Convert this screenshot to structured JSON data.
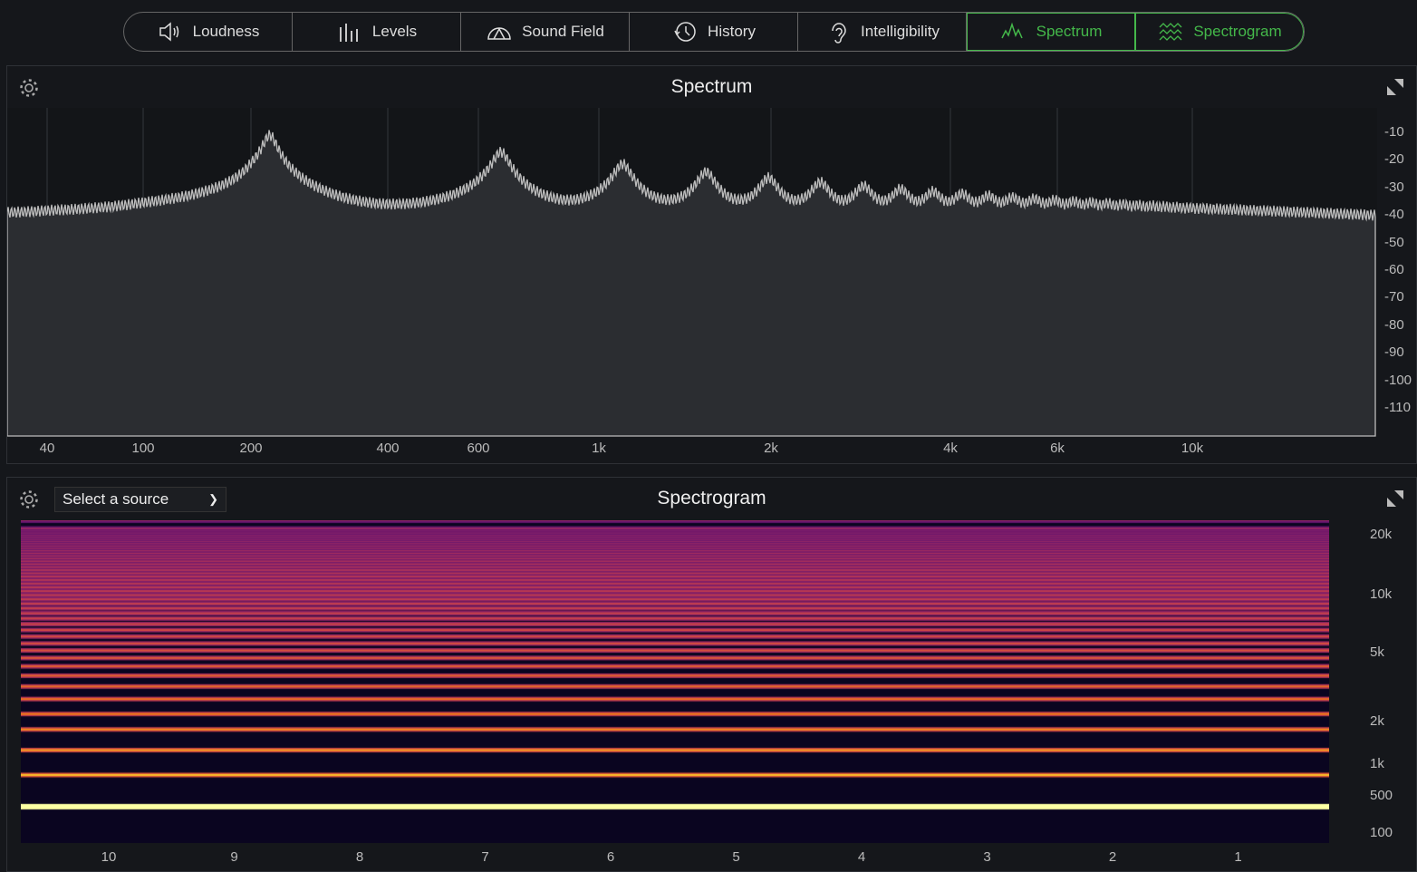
{
  "tabs": [
    {
      "label": "Loudness",
      "icon": "speaker-icon",
      "active": false
    },
    {
      "label": "Levels",
      "icon": "level-bars-icon",
      "active": false
    },
    {
      "label": "Sound Field",
      "icon": "sound-field-icon",
      "active": false
    },
    {
      "label": "History",
      "icon": "history-icon",
      "active": false
    },
    {
      "label": "Intelligibility",
      "icon": "ear-icon",
      "active": false
    },
    {
      "label": "Spectrum",
      "icon": "spectrum-icon",
      "active": true
    },
    {
      "label": "Spectrogram",
      "icon": "spectrogram-icon",
      "active": true
    }
  ],
  "accent": "#44b84a",
  "spectrum": {
    "title": "Spectrum",
    "x_ticks": [
      "40",
      "100",
      "200",
      "400",
      "600",
      "1k",
      "2k",
      "4k",
      "6k",
      "10k"
    ],
    "y_ticks": [
      "-10",
      "-20",
      "-30",
      "-40",
      "-50",
      "-60",
      "-70",
      "-80",
      "-90",
      "-100",
      "-110"
    ]
  },
  "spectrogram": {
    "title": "Spectrogram",
    "source_select": "Select a source",
    "y_ticks": [
      "20k",
      "10k",
      "5k",
      "2k",
      "1k",
      "500",
      "100"
    ],
    "x_ticks": [
      "10",
      "9",
      "8",
      "7",
      "6",
      "5",
      "4",
      "3",
      "2",
      "1"
    ]
  }
}
